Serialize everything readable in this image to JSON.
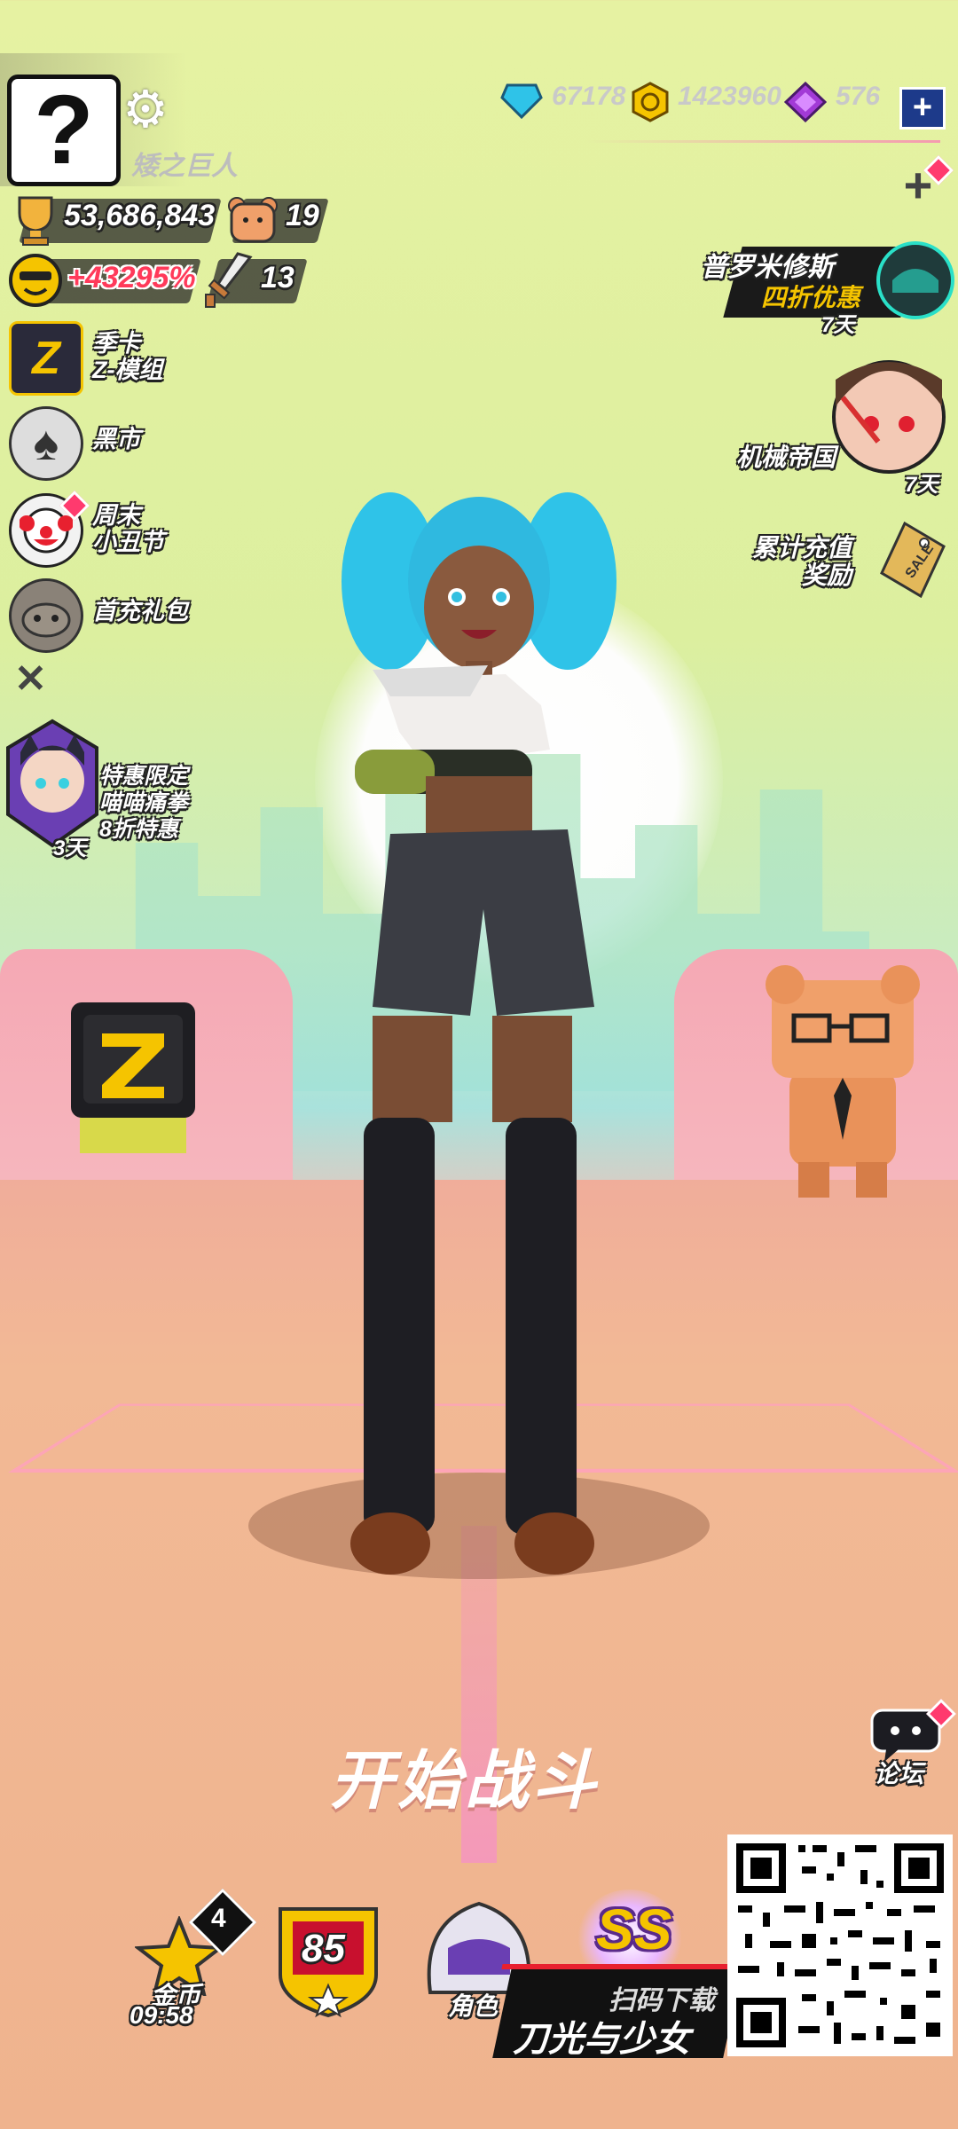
{
  "header": {
    "username": "矮之巨人",
    "avatar_glyph": "?",
    "trophies": "53,686,843",
    "bears": "19",
    "bonus_percent": "+43295%",
    "swords": "13"
  },
  "resources": {
    "gems": "67178",
    "coins": "1423960",
    "crystals": "576"
  },
  "left_menu": [
    {
      "line1": "季卡",
      "line2": "Z-模组"
    },
    {
      "line1": "黑市",
      "line2": ""
    },
    {
      "line1": "周末",
      "line2": "小丑节"
    },
    {
      "line1": "首充礼包",
      "line2": ""
    }
  ],
  "promo_left": {
    "line1": "特惠限定",
    "line2": "喵喵痛拳",
    "line3": "8折特惠",
    "days": "3天"
  },
  "right_menu": {
    "prometheus_title": "普罗米修斯",
    "prometheus_sub": "四折优惠",
    "prometheus_days": "7天",
    "machine_empire": "机械帝国",
    "machine_days": "7天",
    "recharge_line1": "累计充值",
    "recharge_line2": "奖励",
    "sale_tag": "SALE"
  },
  "start_battle": "开始战斗",
  "forum_label": "论坛",
  "bottom_bar": {
    "coin_badge": "4",
    "coin_label": "金币",
    "coin_timer": "09:58",
    "level": "85",
    "character_label": "角色",
    "rank": "SS"
  },
  "download": {
    "line1": "扫码下载",
    "line2": "刀光与少女"
  },
  "colors": {
    "bonus_red": "#ff3a5a",
    "gold": "#f5c400",
    "purple": "#a23ad6",
    "cyan": "#35c6e6"
  }
}
